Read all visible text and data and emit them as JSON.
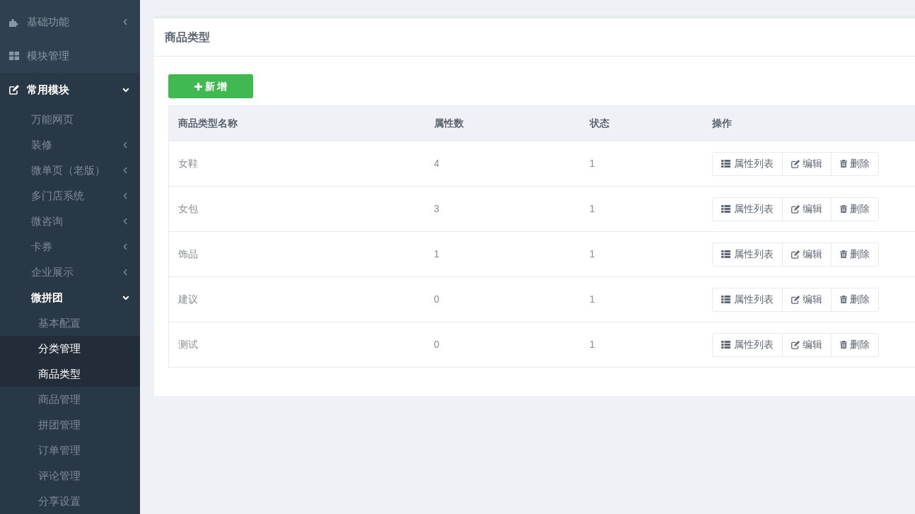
{
  "sidebar": {
    "items": [
      {
        "label": "基础功能",
        "selected": false,
        "expanded": false
      },
      {
        "label": "模块管理",
        "selected": false
      },
      {
        "label": "常用模块",
        "selected": false,
        "expanded": true,
        "children": [
          {
            "label": "万能网页",
            "selected": false
          },
          {
            "label": "装修",
            "selected": false,
            "expanded": false
          },
          {
            "label": "微单页（老版）",
            "selected": false,
            "expanded": false
          },
          {
            "label": "多门店系统",
            "selected": false,
            "expanded": false
          },
          {
            "label": "微咨询",
            "selected": false,
            "expanded": false
          },
          {
            "label": "卡券",
            "selected": false,
            "expanded": false
          },
          {
            "label": "企业展示",
            "selected": false,
            "expanded": false
          },
          {
            "label": "微拼团",
            "selected": false,
            "expanded": true,
            "children": [
              {
                "label": "基本配置",
                "selected": false
              },
              {
                "label": "分类管理",
                "selected": true
              },
              {
                "label": "商品类型",
                "selected": true
              },
              {
                "label": "商品管理",
                "selected": false
              },
              {
                "label": "拼团管理",
                "selected": false
              },
              {
                "label": "订单管理",
                "selected": false
              },
              {
                "label": "评论管理",
                "selected": false
              },
              {
                "label": "分享设置",
                "selected": false
              }
            ]
          }
        ]
      }
    ]
  },
  "panel": {
    "title": "商品类型",
    "add_button": "新 增",
    "table": {
      "columns": [
        "商品类型名称",
        "属性数",
        "状态",
        "操作"
      ],
      "rows": [
        {
          "cells": [
            "女鞋",
            "4",
            "1"
          ],
          "actions": [
            "属性列表",
            "编辑",
            "删除"
          ]
        },
        {
          "cells": [
            "女包",
            "3",
            "1"
          ],
          "actions": [
            "属性列表",
            "编辑",
            "删除"
          ]
        },
        {
          "cells": [
            "饰品",
            "1",
            "1"
          ],
          "actions": [
            "属性列表",
            "编辑",
            "删除"
          ]
        },
        {
          "cells": [
            "建议",
            "0",
            "1"
          ],
          "actions": [
            "属性列表",
            "编辑",
            "删除"
          ]
        },
        {
          "cells": [
            "测试",
            "0",
            "1"
          ],
          "actions": [
            "属性列表",
            "编辑",
            "删除"
          ]
        }
      ]
    }
  }
}
